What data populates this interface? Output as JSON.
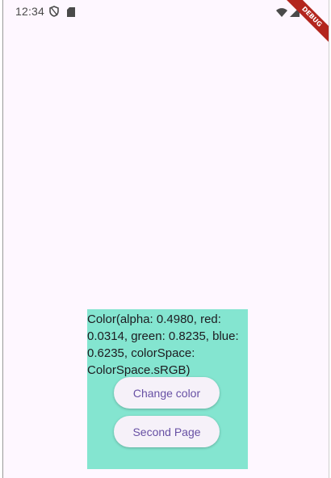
{
  "status_bar": {
    "time": "12:34",
    "icons": [
      "shield-icon",
      "sd-card-icon",
      "wifi-icon",
      "signal-icon",
      "battery-icon"
    ]
  },
  "debug_banner": {
    "label": "DEBUG"
  },
  "panel": {
    "background_color": "#84e5d0",
    "color_text": "Color(alpha: 0.4980, red: 0.0314, green: 0.8235, blue: 0.6235, colorSpace: ColorSpace.sRGB)",
    "buttons": {
      "change_color": "Change color",
      "second_page": "Second Page"
    }
  },
  "colors": {
    "screen_background": "#fef7ff",
    "button_text": "#6750a4",
    "debug_ribbon": "#b3261e"
  }
}
